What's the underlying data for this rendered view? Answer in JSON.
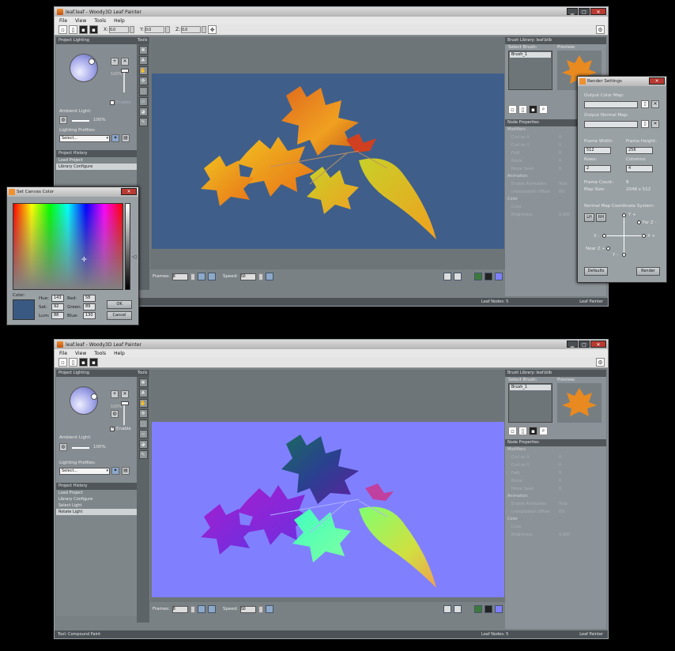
{
  "window1": {
    "title": "leaf.leaf - Woody3D Leaf Painter",
    "status_left": "",
    "status_mid": "Leaf Nodes: 5",
    "status_right": "Leaf Painter",
    "history": [
      "Load Project",
      "Library Configure"
    ],
    "history_selected": 1,
    "canvas_color": "#3f5f8a",
    "enable_label": "Enable"
  },
  "window2": {
    "title": "leaf.leaf - Woody3D Leaf Painter",
    "status_left": "Tool: Compound Paint",
    "status_mid": "Leaf Nodes: 5",
    "status_right": "Leaf Painter",
    "history": [
      "Load Project",
      "Library Configure",
      "Select Light",
      "Rotate Light"
    ],
    "history_selected": 3,
    "canvas_color": "#8080ff",
    "enable_label": "Enable"
  },
  "menu": [
    "File",
    "View",
    "Tools",
    "Help"
  ],
  "toolbar": {
    "x_label": "X:",
    "y_label": "Y:",
    "z_label": "Z:",
    "x_val": "0.0",
    "y_val": "0.0",
    "z_val": "0.0"
  },
  "left": {
    "lighting_header": "Project Lighting",
    "percent": "100%",
    "ambient_label": "Ambient Light:",
    "ambient_pct": "100%",
    "profiles_label": "Lighting Profiles:",
    "profiles_value": "Select...",
    "history_header": "Project History",
    "tools_header": "Tools"
  },
  "viewport_bar": {
    "frames_label": "Frames:",
    "frames_value": "8",
    "speed_label": "Speed:",
    "speed_value": "50"
  },
  "right": {
    "library_title": "Brush Library: leaf.blib",
    "select_brush": "Select Brush:",
    "preview": "Preview:",
    "brush": "Brush_1",
    "node_props": "Node Properties",
    "modifiers": "Modifiers",
    "curl_x": "Curl on X",
    "curl_x_v": "0",
    "curl_y": "Curl on Y",
    "curl_y_v": "0",
    "fold": "Fold",
    "fold_v": "0",
    "noise": "Noise",
    "noise_v": "0",
    "noise_seed": "Noise Seed",
    "noise_seed_v": "0",
    "animation": "Animation",
    "enable_anim": "Enable Animation",
    "enable_anim_v": "True",
    "interp": "Interpolation Offset",
    "interp_v": "0%",
    "color_cat": "Color",
    "color": "Color",
    "color_v": "",
    "brightness": "Brightness",
    "brightness_v": "0.000"
  },
  "color_dialog": {
    "title": "Set Canvas Color",
    "color_label": "Color:",
    "hue_l": "Hue:",
    "hue": "143",
    "sat_l": "Sat:",
    "sat": "92",
    "lum_l": "Lum:",
    "lum": "88",
    "red_l": "Red:",
    "red": "58",
    "green_l": "Green:",
    "green": "89",
    "blue_l": "Blue:",
    "blue": "130",
    "ok": "OK",
    "cancel": "Cancel",
    "swatch": "#3a5982"
  },
  "render_dialog": {
    "title": "Render Settings",
    "out_color": "Output Color Map:",
    "out_normal": "Output Normal Map:",
    "fw_l": "Frame Width:",
    "fw": "512",
    "fh_l": "Frame Height:",
    "fh": "256",
    "rows_l": "Rows:",
    "rows": "2",
    "cols_l": "Columns:",
    "cols": "4",
    "fc_l": "Frame Count:",
    "fc": "8",
    "ms_l": "Map Size:",
    "ms": "2048 x 512",
    "ncs": "Normal Map Coordinate System:",
    "lh": "LH",
    "rh": "RH",
    "ypos": "Y +",
    "yneg": "Y -",
    "xpos": "X +",
    "xneg": "X -",
    "farz": "Far Z -",
    "nearz": "Near Z +",
    "defaults": "Defaults",
    "render": "Render"
  }
}
